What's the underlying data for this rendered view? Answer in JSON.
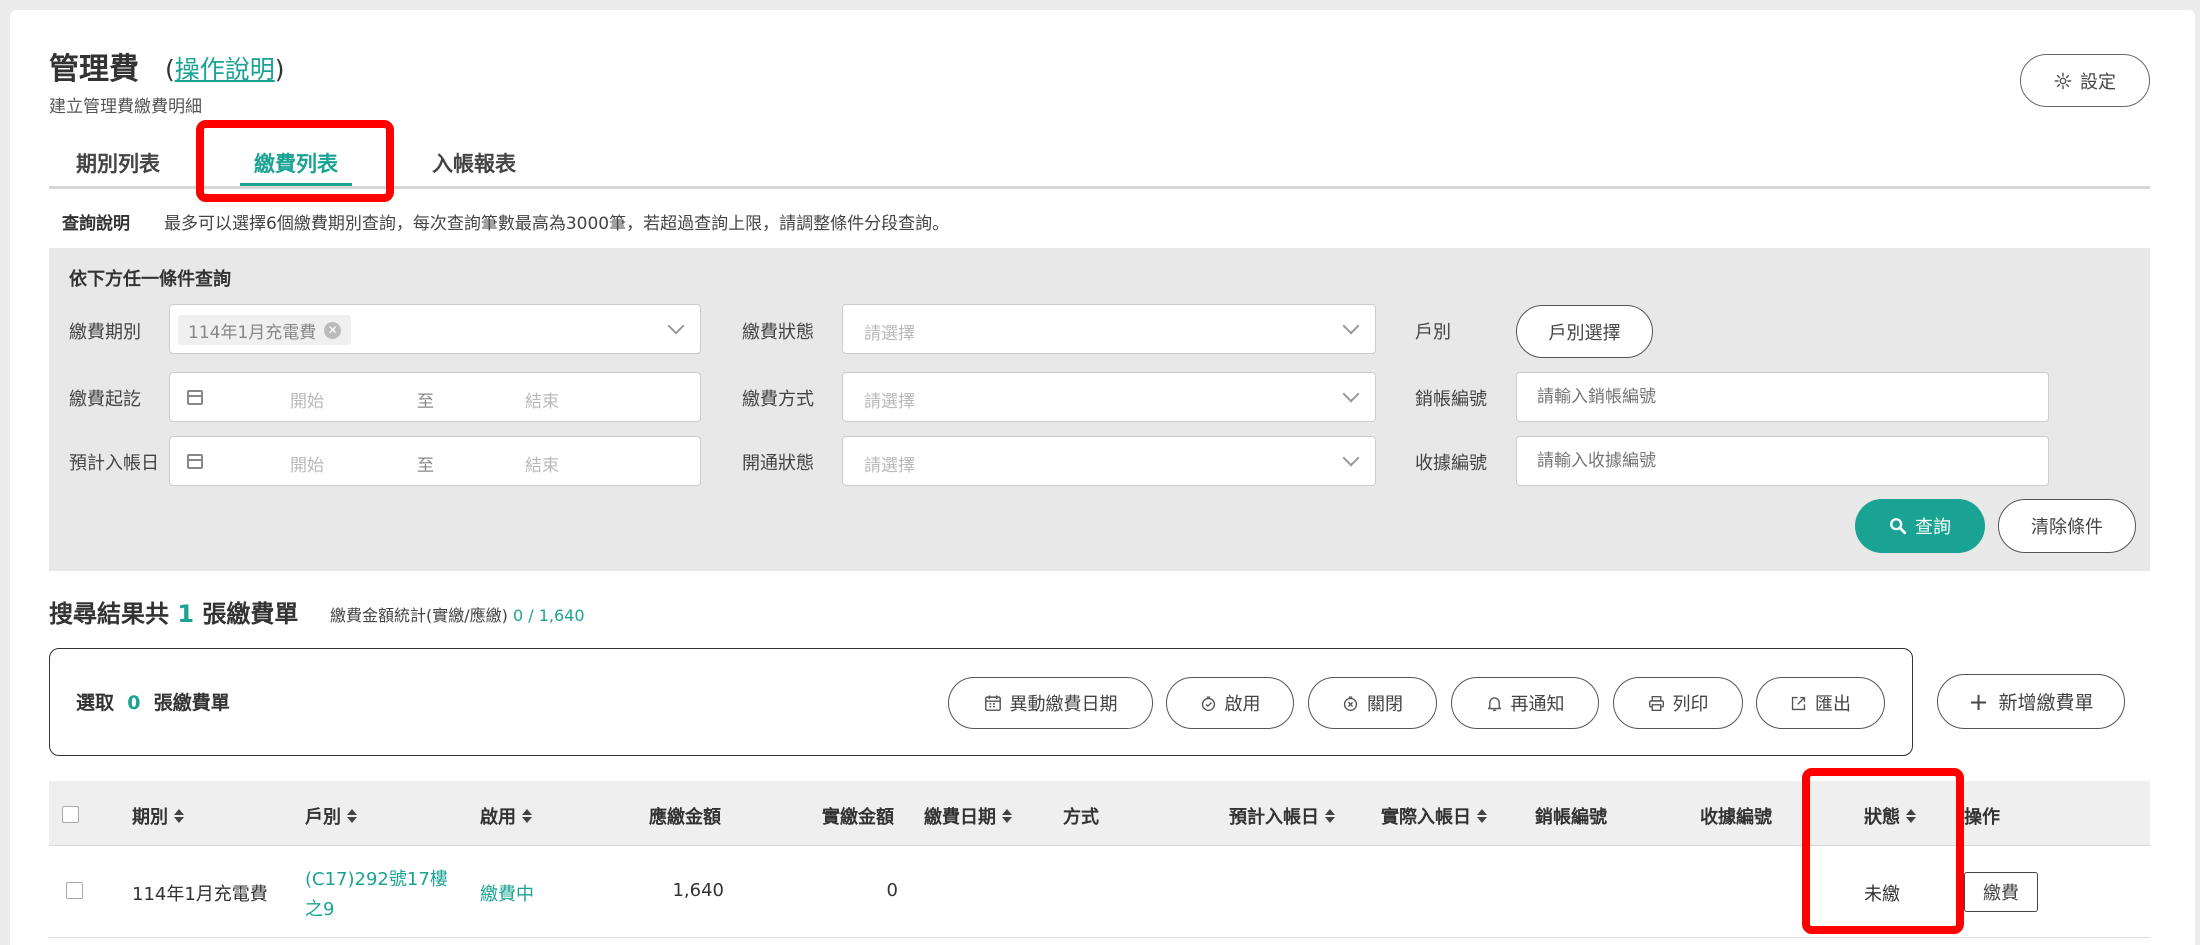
{
  "header": {
    "title": "管理費",
    "help_open": "(",
    "help_link": "操作說明",
    "help_close": ")",
    "subtitle": "建立管理費繳費明細",
    "settings_label": "設定"
  },
  "tabs": [
    {
      "label": "期別列表",
      "active": false
    },
    {
      "label": "繳費列表",
      "active": true
    },
    {
      "label": "入帳報表",
      "active": false
    }
  ],
  "query_note": {
    "label": "查詢說明",
    "text": "最多可以選擇6個繳費期別查詢，每次查詢筆數最高為3000筆，若超過查詢上限，請調整條件分段查詢。"
  },
  "filters": {
    "title": "依下方任一條件查詢",
    "period_label": "繳費期別",
    "period_tag": "114年1月充電費",
    "pay_start_label": "繳費起訖",
    "expected_label": "預計入帳日",
    "date_start_ph": "開始",
    "date_to": "至",
    "date_end_ph": "結束",
    "status_label": "繳費狀態",
    "method_label": "繳費方式",
    "open_label": "開通狀態",
    "select_ph": "請選擇",
    "household_label": "戶別",
    "household_btn": "戶別選擇",
    "writeoff_label": "銷帳編號",
    "writeoff_ph": "請輸入銷帳編號",
    "receipt_label": "收據編號",
    "receipt_ph": "請輸入收據編號",
    "query_btn": "查詢",
    "clear_btn": "清除條件"
  },
  "results": {
    "prefix": "搜尋結果共",
    "count": "1",
    "suffix": "張繳費單",
    "stats_label": "繳費金額統計(實繳/應繳)",
    "stats_value": "0 / 1,640"
  },
  "selection": {
    "prefix": "選取",
    "count": "0",
    "suffix": "張繳費單",
    "actions": [
      "異動繳費日期",
      "啟用",
      "關閉",
      "再通知",
      "列印",
      "匯出"
    ],
    "new_btn": "新增繳費單"
  },
  "table": {
    "headers": {
      "period": "期別",
      "household": "戶別",
      "enabled": "啟用",
      "due": "應繳金額",
      "paid": "實繳金額",
      "pay_date": "繳費日期",
      "method": "方式",
      "expected_date": "預計入帳日",
      "actual_date": "實際入帳日",
      "writeoff": "銷帳編號",
      "receipt": "收據編號",
      "status": "狀態",
      "ops": "操作"
    },
    "rows": [
      {
        "period": "114年1月充電費",
        "household_line1": "(C17)292號17樓",
        "household_line2": "之9",
        "enabled": "繳費中",
        "due": "1,640",
        "paid": "0",
        "status": "未繳",
        "action": "繳費"
      }
    ]
  },
  "colors": {
    "accent": "#1aa393",
    "highlight": "#ff0000"
  }
}
